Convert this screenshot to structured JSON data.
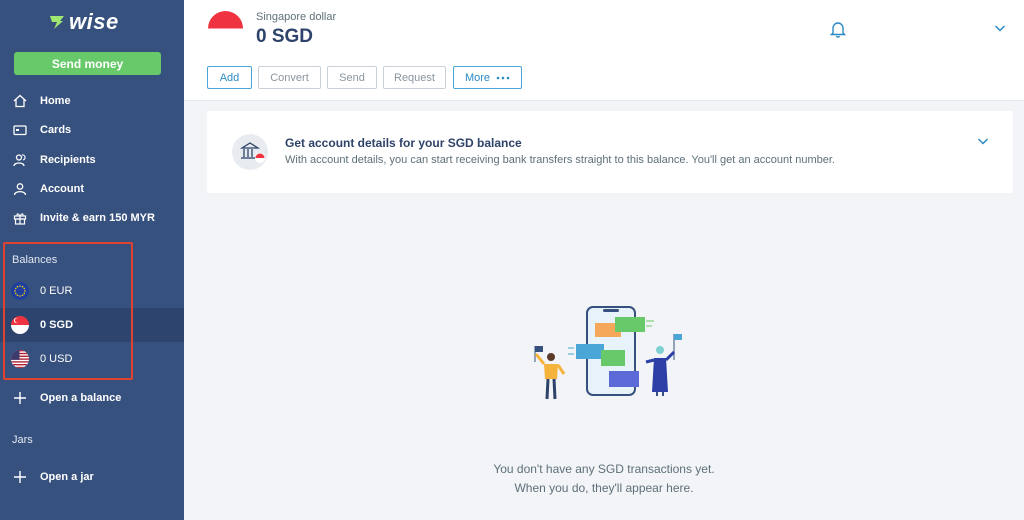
{
  "sidebar": {
    "logo_text": "wise",
    "send_money": "Send money",
    "nav": [
      {
        "label": "Home",
        "icon": "home-icon"
      },
      {
        "label": "Cards",
        "icon": "card-icon"
      },
      {
        "label": "Recipients",
        "icon": "recipients-icon"
      },
      {
        "label": "Account",
        "icon": "account-icon"
      },
      {
        "label": "Invite & earn 150 MYR",
        "icon": "gift-icon"
      }
    ],
    "balances_label": "Balances",
    "balances": [
      {
        "label": "0 EUR",
        "flag": "eu-flag-icon",
        "active": false
      },
      {
        "label": "0 SGD",
        "flag": "sg-flag-icon",
        "active": true
      },
      {
        "label": "0 USD",
        "flag": "us-flag-icon",
        "active": false
      }
    ],
    "open_balance": "Open a balance",
    "jars_label": "Jars",
    "open_jar": "Open a jar"
  },
  "header": {
    "currency_name": "Singapore dollar",
    "amount": "0 SGD",
    "actions": {
      "add": "Add",
      "convert": "Convert",
      "send": "Send",
      "request": "Request",
      "more": "More"
    }
  },
  "details_card": {
    "title": "Get account details for your SGD balance",
    "subtitle": "With account details, you can start receiving bank transfers straight to this balance. You'll get an account number."
  },
  "empty_state": {
    "line1": "You don't have any SGD transactions yet.",
    "line2": "When you do, they'll appear here."
  },
  "colors": {
    "sidebar": "#37517e",
    "send_button": "#68c96a",
    "accent": "#2b8ac6",
    "highlight_box": "#e0422e"
  }
}
